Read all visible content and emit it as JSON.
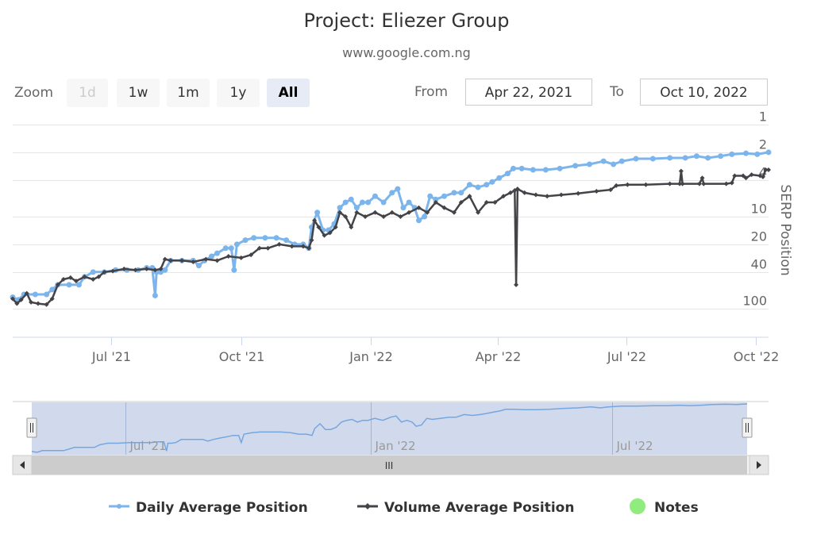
{
  "header": {
    "title": "Project: Eliezer Group",
    "subtitle": "www.google.com.ng"
  },
  "range_selector": {
    "zoom_label": "Zoom",
    "buttons": [
      {
        "label": "1d",
        "state": "disabled"
      },
      {
        "label": "1w",
        "state": "normal"
      },
      {
        "label": "1m",
        "state": "normal"
      },
      {
        "label": "1y",
        "state": "normal"
      },
      {
        "label": "All",
        "state": "active"
      }
    ],
    "from_label": "From",
    "from_value": "Apr 22, 2021",
    "to_label": "To",
    "to_value": "Oct 10, 2022"
  },
  "navigator": {
    "tick_labels": [
      "Jul '21",
      "Jan '22",
      "Jul '22"
    ],
    "scrollbar_grip": "III"
  },
  "legend": {
    "items": [
      {
        "label": "Daily Average Position",
        "color": "#7cb5ec"
      },
      {
        "label": "Volume Average Position",
        "color": "#434348"
      },
      {
        "label": "Notes",
        "color": "#90ed7d"
      }
    ]
  },
  "colors": {
    "daily": "#7cb5ec",
    "volume": "#434348",
    "notes": "#90ed7d",
    "grid": "#e6e6e6",
    "axis": "#ccd6eb",
    "navigator_mask": "rgba(102,133,194,0.3)"
  },
  "chart_data": {
    "type": "line",
    "title": "Project: Eliezer Group",
    "subtitle": "www.google.com.ng",
    "xlabel": "",
    "ylabel": "SERP Position",
    "y_scale": "log",
    "y_reversed": true,
    "ylim": [
      1,
      200
    ],
    "y_ticks": [
      1,
      2,
      4,
      10,
      20,
      40,
      100
    ],
    "x_range": [
      "2021-04-22",
      "2022-10-10"
    ],
    "x_ticks": [
      {
        "date": "2021-07-01",
        "label": "Jul '21"
      },
      {
        "date": "2021-10-01",
        "label": "Oct '21"
      },
      {
        "date": "2022-01-01",
        "label": "Jan '22"
      },
      {
        "date": "2022-04-01",
        "label": "Apr '22"
      },
      {
        "date": "2022-07-01",
        "label": "Jul '22"
      },
      {
        "date": "2022-10-01",
        "label": "Oct '22"
      }
    ],
    "grid": true,
    "legend_position": "bottom",
    "series": [
      {
        "name": "Daily Average Position",
        "points": [
          [
            "2021-04-22",
            75
          ],
          [
            "2021-04-26",
            80
          ],
          [
            "2021-04-30",
            70
          ],
          [
            "2021-05-08",
            70
          ],
          [
            "2021-05-16",
            70
          ],
          [
            "2021-05-20",
            62
          ],
          [
            "2021-05-24",
            55
          ],
          [
            "2021-06-01",
            55
          ],
          [
            "2021-06-08",
            55
          ],
          [
            "2021-06-12",
            45
          ],
          [
            "2021-06-18",
            40
          ],
          [
            "2021-06-26",
            40
          ],
          [
            "2021-07-04",
            38
          ],
          [
            "2021-07-12",
            38
          ],
          [
            "2021-07-20",
            38
          ],
          [
            "2021-07-26",
            36
          ],
          [
            "2021-07-30",
            36
          ],
          [
            "2021-08-01",
            72
          ],
          [
            "2021-08-02",
            40
          ],
          [
            "2021-08-05",
            40
          ],
          [
            "2021-08-08",
            38
          ],
          [
            "2021-08-12",
            30
          ],
          [
            "2021-08-20",
            30
          ],
          [
            "2021-08-28",
            30
          ],
          [
            "2021-09-01",
            34
          ],
          [
            "2021-09-05",
            30
          ],
          [
            "2021-09-10",
            27
          ],
          [
            "2021-09-14",
            25
          ],
          [
            "2021-09-20",
            22
          ],
          [
            "2021-09-24",
            22
          ],
          [
            "2021-09-26",
            38
          ],
          [
            "2021-09-28",
            20
          ],
          [
            "2021-10-04",
            18
          ],
          [
            "2021-10-10",
            17
          ],
          [
            "2021-10-18",
            17
          ],
          [
            "2021-10-26",
            17
          ],
          [
            "2021-11-02",
            18
          ],
          [
            "2021-11-08",
            20
          ],
          [
            "2021-11-14",
            20
          ],
          [
            "2021-11-18",
            22
          ],
          [
            "2021-11-20",
            13
          ],
          [
            "2021-11-24",
            9
          ],
          [
            "2021-11-28",
            14
          ],
          [
            "2021-12-02",
            14
          ],
          [
            "2021-12-06",
            12
          ],
          [
            "2021-12-10",
            8
          ],
          [
            "2021-12-14",
            7
          ],
          [
            "2021-12-18",
            6.5
          ],
          [
            "2021-12-22",
            8
          ],
          [
            "2021-12-26",
            7
          ],
          [
            "2021-12-30",
            7
          ],
          [
            "2022-01-04",
            6
          ],
          [
            "2022-01-10",
            7
          ],
          [
            "2022-01-16",
            5.5
          ],
          [
            "2022-01-20",
            5
          ],
          [
            "2022-01-24",
            8
          ],
          [
            "2022-01-28",
            7
          ],
          [
            "2022-02-01",
            8
          ],
          [
            "2022-02-04",
            11
          ],
          [
            "2022-02-08",
            10
          ],
          [
            "2022-02-12",
            6
          ],
          [
            "2022-02-16",
            6.5
          ],
          [
            "2022-02-22",
            6
          ],
          [
            "2022-03-01",
            5.5
          ],
          [
            "2022-03-06",
            5.5
          ],
          [
            "2022-03-12",
            4.5
          ],
          [
            "2022-03-18",
            4.8
          ],
          [
            "2022-03-24",
            4.5
          ],
          [
            "2022-03-28",
            4.2
          ],
          [
            "2022-04-02",
            3.8
          ],
          [
            "2022-04-08",
            3.4
          ],
          [
            "2022-04-12",
            3.0
          ],
          [
            "2022-04-18",
            3.0
          ],
          [
            "2022-04-26",
            3.1
          ],
          [
            "2022-05-05",
            3.1
          ],
          [
            "2022-05-15",
            3.0
          ],
          [
            "2022-05-26",
            2.8
          ],
          [
            "2022-06-05",
            2.7
          ],
          [
            "2022-06-15",
            2.5
          ],
          [
            "2022-06-22",
            2.7
          ],
          [
            "2022-06-28",
            2.5
          ],
          [
            "2022-07-08",
            2.35
          ],
          [
            "2022-07-20",
            2.35
          ],
          [
            "2022-08-01",
            2.3
          ],
          [
            "2022-08-12",
            2.3
          ],
          [
            "2022-08-20",
            2.2
          ],
          [
            "2022-08-28",
            2.3
          ],
          [
            "2022-09-06",
            2.2
          ],
          [
            "2022-09-14",
            2.1
          ],
          [
            "2022-09-24",
            2.05
          ],
          [
            "2022-10-02",
            2.1
          ],
          [
            "2022-10-10",
            2.0
          ]
        ]
      },
      {
        "name": "Volume Average Position",
        "points": [
          [
            "2021-04-22",
            78
          ],
          [
            "2021-04-25",
            88
          ],
          [
            "2021-04-28",
            80
          ],
          [
            "2021-05-02",
            68
          ],
          [
            "2021-05-05",
            85
          ],
          [
            "2021-05-10",
            88
          ],
          [
            "2021-05-16",
            90
          ],
          [
            "2021-05-20",
            78
          ],
          [
            "2021-05-24",
            55
          ],
          [
            "2021-05-28",
            48
          ],
          [
            "2021-06-02",
            46
          ],
          [
            "2021-06-06",
            50
          ],
          [
            "2021-06-12",
            45
          ],
          [
            "2021-06-18",
            48
          ],
          [
            "2021-06-22",
            45
          ],
          [
            "2021-06-26",
            40
          ],
          [
            "2021-07-02",
            39
          ],
          [
            "2021-07-10",
            37
          ],
          [
            "2021-07-18",
            38
          ],
          [
            "2021-07-26",
            37
          ],
          [
            "2021-08-01",
            38
          ],
          [
            "2021-08-05",
            37
          ],
          [
            "2021-08-08",
            29
          ],
          [
            "2021-08-12",
            30
          ],
          [
            "2021-08-20",
            30
          ],
          [
            "2021-08-28",
            31
          ],
          [
            "2021-09-06",
            29
          ],
          [
            "2021-09-14",
            30
          ],
          [
            "2021-09-22",
            27
          ],
          [
            "2021-10-01",
            28
          ],
          [
            "2021-10-08",
            26
          ],
          [
            "2021-10-14",
            22
          ],
          [
            "2021-10-20",
            22
          ],
          [
            "2021-10-28",
            20
          ],
          [
            "2021-11-06",
            21
          ],
          [
            "2021-11-14",
            21
          ],
          [
            "2021-11-18",
            22
          ],
          [
            "2021-11-20",
            18
          ],
          [
            "2021-11-22",
            11
          ],
          [
            "2021-11-25",
            13
          ],
          [
            "2021-11-29",
            16
          ],
          [
            "2021-12-03",
            15
          ],
          [
            "2021-12-07",
            13
          ],
          [
            "2021-12-10",
            9
          ],
          [
            "2021-12-14",
            10
          ],
          [
            "2021-12-18",
            13
          ],
          [
            "2021-12-22",
            9
          ],
          [
            "2021-12-28",
            10
          ],
          [
            "2022-01-04",
            9
          ],
          [
            "2022-01-10",
            10
          ],
          [
            "2022-01-16",
            9
          ],
          [
            "2022-01-22",
            10
          ],
          [
            "2022-01-28",
            9
          ],
          [
            "2022-02-04",
            8
          ],
          [
            "2022-02-10",
            9
          ],
          [
            "2022-02-16",
            7
          ],
          [
            "2022-02-22",
            8
          ],
          [
            "2022-03-01",
            9
          ],
          [
            "2022-03-06",
            7
          ],
          [
            "2022-03-12",
            6
          ],
          [
            "2022-03-18",
            9
          ],
          [
            "2022-03-24",
            7
          ],
          [
            "2022-03-30",
            7
          ],
          [
            "2022-04-05",
            6
          ],
          [
            "2022-04-10",
            5.5
          ],
          [
            "2022-04-13",
            5.2
          ],
          [
            "2022-04-14",
            55
          ],
          [
            "2022-04-15",
            5.0
          ],
          [
            "2022-04-20",
            5.5
          ],
          [
            "2022-04-28",
            5.8
          ],
          [
            "2022-05-06",
            6
          ],
          [
            "2022-05-16",
            5.8
          ],
          [
            "2022-05-28",
            5.6
          ],
          [
            "2022-06-10",
            5.3
          ],
          [
            "2022-06-20",
            5.1
          ],
          [
            "2022-06-24",
            4.6
          ],
          [
            "2022-07-02",
            4.5
          ],
          [
            "2022-07-15",
            4.5
          ],
          [
            "2022-08-01",
            4.4
          ],
          [
            "2022-08-08",
            4.4
          ],
          [
            "2022-08-09",
            3.2
          ],
          [
            "2022-08-10",
            4.4
          ],
          [
            "2022-08-22",
            4.4
          ],
          [
            "2022-08-24",
            3.8
          ],
          [
            "2022-08-25",
            4.4
          ],
          [
            "2022-09-10",
            4.4
          ],
          [
            "2022-09-14",
            4.3
          ],
          [
            "2022-09-16",
            3.6
          ],
          [
            "2022-09-22",
            3.6
          ],
          [
            "2022-09-24",
            3.8
          ],
          [
            "2022-09-28",
            3.5
          ],
          [
            "2022-10-04",
            3.6
          ],
          [
            "2022-10-06",
            3.7
          ],
          [
            "2022-10-08",
            3.1
          ],
          [
            "2022-10-10",
            3.1
          ]
        ]
      },
      {
        "name": "Notes",
        "points": []
      }
    ]
  }
}
